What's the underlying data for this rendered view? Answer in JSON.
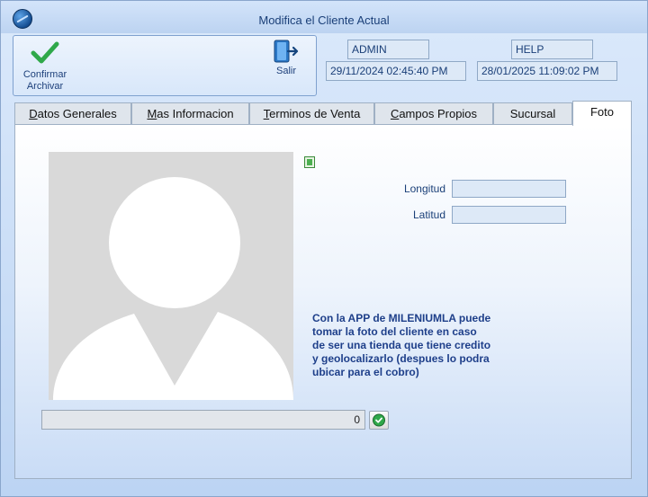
{
  "window": {
    "title": "Modifica el Cliente Actual"
  },
  "toolbar": {
    "confirm_label_line1": "Confirmar",
    "confirm_label_line2": "Archivar",
    "exit_label": "Salir"
  },
  "header_fields": {
    "user": "ADMIN",
    "help": "HELP",
    "created_at": "29/11/2024 02:45:40 PM",
    "modified_at": "28/01/2025 11:09:02 PM"
  },
  "tabs": [
    {
      "label": "Datos Generales",
      "accel": "D",
      "rest": "atos Generales"
    },
    {
      "label": "Mas Informacion",
      "accel": "M",
      "rest": "as Informacion"
    },
    {
      "label": "Terminos de Venta",
      "accel": "T",
      "rest": "erminos de Venta"
    },
    {
      "label": "Campos Propios",
      "accel": "C",
      "rest": "ampos Propios"
    },
    {
      "label": "Sucursal"
    },
    {
      "label": "Foto"
    }
  ],
  "active_tab": "Foto",
  "foto": {
    "longitud_label": "Longitud",
    "longitud_value": "",
    "latitud_label": "Latitud",
    "latitud_value": "",
    "info_text": "Con la APP de MILENIUMLA puede tomar la foto del cliente en caso de ser una tienda que tiene credito y geolocalizarlo (despues lo podra ubicar para el cobro)",
    "counter_value": "0"
  },
  "icons": {
    "app": "globe-icon",
    "confirm": "checkmark-icon",
    "exit": "exit-door-icon",
    "photo": "user-silhouette-icon",
    "doc": "document-icon",
    "ok": "check-circle-icon"
  },
  "colors": {
    "accent_green": "#2fa84a",
    "title_text": "#1a3f78",
    "info_text": "#1e3f8a"
  }
}
